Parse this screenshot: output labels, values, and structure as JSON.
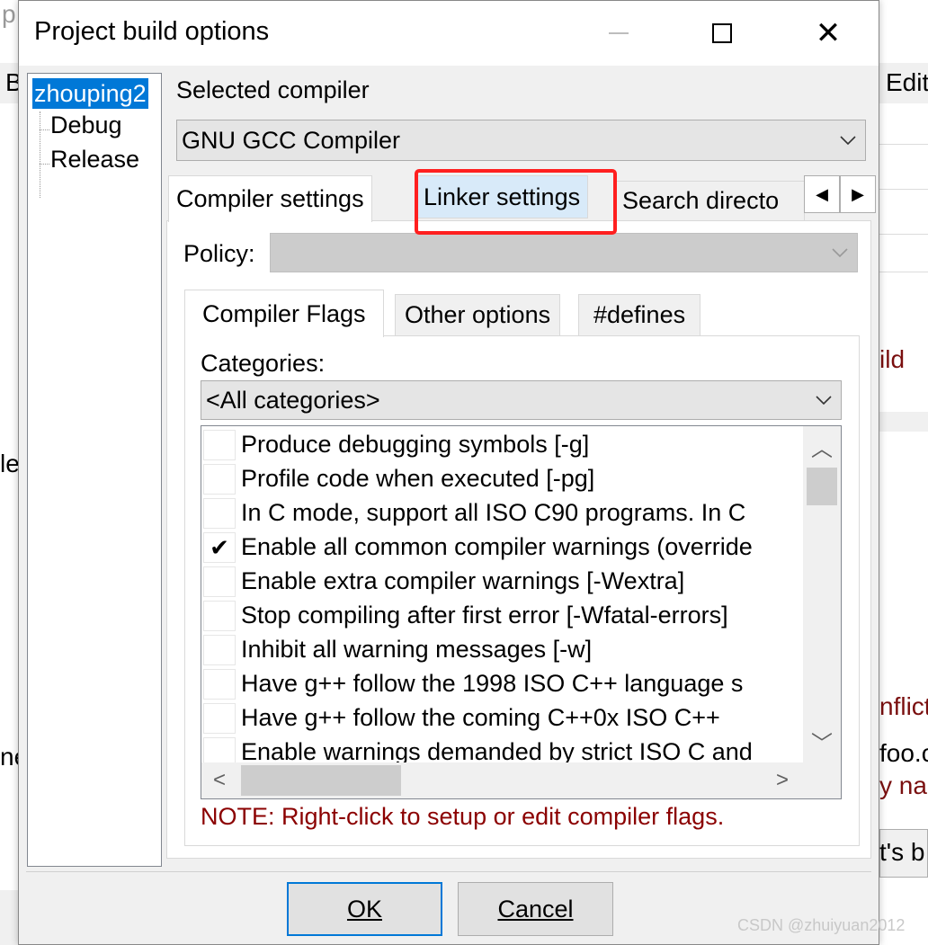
{
  "background": {
    "top_left_char": "p",
    "left_menu_char": "B",
    "right_menu": "Edit",
    "left_fragment_1": "le",
    "left_fragment_2": "ne",
    "right_build": "ild",
    "right_conflict": "nflict",
    "right_foo": "foo.c",
    "right_name": "y nar",
    "right_bottom": "t's b"
  },
  "dialog": {
    "title": "Project build options",
    "controls": {
      "minimize": "—",
      "maximize": "□",
      "close": "✕"
    }
  },
  "tree": {
    "root": "zhouping2",
    "children": [
      "Debug",
      "Release"
    ]
  },
  "compiler": {
    "label": "Selected compiler",
    "value": "GNU GCC Compiler"
  },
  "top_tabs": {
    "items": [
      "Compiler settings",
      "Linker settings",
      "Search directo"
    ],
    "active": "Compiler settings",
    "highlighted": "Linker settings",
    "scroll_left": "◀",
    "scroll_right": "▶"
  },
  "policy": {
    "label": "Policy:",
    "value": ""
  },
  "inner_tabs": {
    "items": [
      "Compiler Flags",
      "Other options",
      "#defines"
    ],
    "active": "Compiler Flags"
  },
  "categories": {
    "label": "Categories:",
    "value": "<All categories>"
  },
  "flags": [
    {
      "checked": false,
      "text": "Produce debugging symbols  [-g]"
    },
    {
      "checked": false,
      "text": "Profile code when executed  [-pg]"
    },
    {
      "checked": false,
      "text": "In C mode, support all ISO C90 programs. In C"
    },
    {
      "checked": true,
      "text": "Enable all common compiler warnings (override"
    },
    {
      "checked": false,
      "text": "Enable extra compiler warnings  [-Wextra]"
    },
    {
      "checked": false,
      "text": "Stop compiling after first error  [-Wfatal-errors]"
    },
    {
      "checked": false,
      "text": "Inhibit all warning messages  [-w]"
    },
    {
      "checked": false,
      "text": "Have g++ follow the 1998 ISO C++ language s"
    },
    {
      "checked": false,
      "text": "Have g++ follow the coming C++0x ISO C++"
    },
    {
      "checked": false,
      "text": "Enable warnings demanded by strict ISO C and"
    }
  ],
  "note": "NOTE: Right-click to setup or edit compiler flags.",
  "buttons": {
    "ok": "OK",
    "cancel": "Cancel"
  },
  "watermark": "CSDN @zhuiyuan2012",
  "colors": {
    "selection": "#0078d7",
    "highlight_box": "#ff1f1f",
    "note": "#8b0000"
  }
}
